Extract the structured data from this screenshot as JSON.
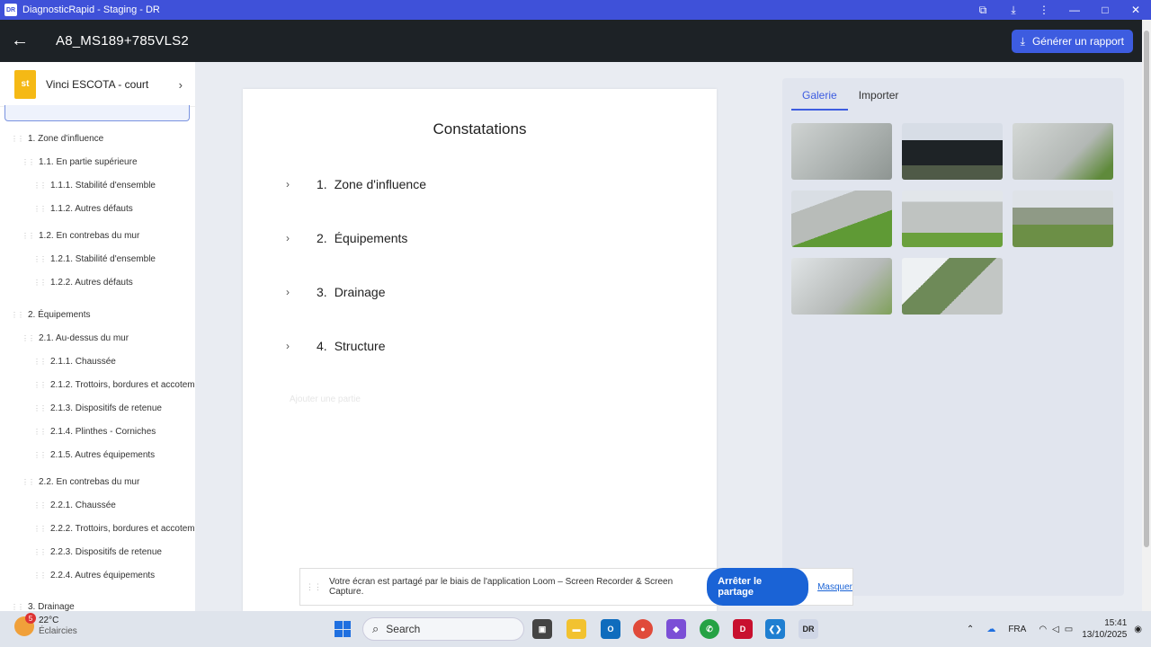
{
  "window": {
    "title": "DiagnosticRapid - Staging - DR",
    "logo": "DR"
  },
  "appbar": {
    "title": "A8_MS189+785VLS2",
    "generate_label": "Générer un rapport"
  },
  "client": {
    "name": "Vinci ESCOTA - court",
    "logo_text": "st"
  },
  "tree": [
    {
      "label": "1. Zone d'influence",
      "level": 0
    },
    {
      "label": "1.1. En partie supérieure",
      "level": 1
    },
    {
      "label": "1.1.1. Stabilité d'ensemble",
      "level": 2
    },
    {
      "label": "1.1.2. Autres défauts",
      "level": 2
    },
    {
      "label": "1.2. En contrebas du mur",
      "level": 1
    },
    {
      "label": "1.2.1. Stabilité d'ensemble",
      "level": 2
    },
    {
      "label": "1.2.2. Autres défauts",
      "level": 2
    },
    {
      "label": "2. Équipements",
      "level": 0
    },
    {
      "label": "2.1. Au-dessus du mur",
      "level": 1
    },
    {
      "label": "2.1.1. Chaussée",
      "level": 2
    },
    {
      "label": "2.1.2. Trottoirs, bordures et accotem",
      "level": 2
    },
    {
      "label": "2.1.3. Dispositifs de retenue",
      "level": 2
    },
    {
      "label": "2.1.4. Plinthes - Corniches",
      "level": 2
    },
    {
      "label": "2.1.5. Autres équipements",
      "level": 2
    },
    {
      "label": "2.2. En contrebas du mur",
      "level": 1
    },
    {
      "label": "2.2.1. Chaussée",
      "level": 2
    },
    {
      "label": "2.2.2. Trottoirs, bordures et accotem",
      "level": 2
    },
    {
      "label": "2.2.3. Dispositifs de retenue",
      "level": 2
    },
    {
      "label": "2.2.4. Autres équipements",
      "level": 2
    },
    {
      "label": "3. Drainage",
      "level": 0
    }
  ],
  "main": {
    "heading": "Constatations",
    "sections": [
      {
        "num": "1.",
        "label": "Zone d'influence"
      },
      {
        "num": "2.",
        "label": "Équipements"
      },
      {
        "num": "3.",
        "label": "Drainage"
      },
      {
        "num": "4.",
        "label": "Structure"
      }
    ],
    "add_part": "Ajouter une partie"
  },
  "gallery": {
    "tabs": [
      "Galerie",
      "Importer"
    ],
    "active_tab": "Galerie",
    "photo_count": 8
  },
  "loom": {
    "message": "Votre écran est partagé par le biais de l'application Loom – Screen Recorder & Screen Capture.",
    "stop_label": "Arrêter le partage",
    "hide_label": "Masquer"
  },
  "taskbar": {
    "weather_temp": "22°C",
    "weather_desc": "Éclaircies",
    "weather_badge": "5",
    "search_placeholder": "Search",
    "language": "FRA",
    "time": "15:41",
    "date": "13/10/2025"
  },
  "colors": {
    "accent": "#3d5ce0",
    "titlebar": "#3f51d9",
    "appbar": "#1d2226"
  }
}
